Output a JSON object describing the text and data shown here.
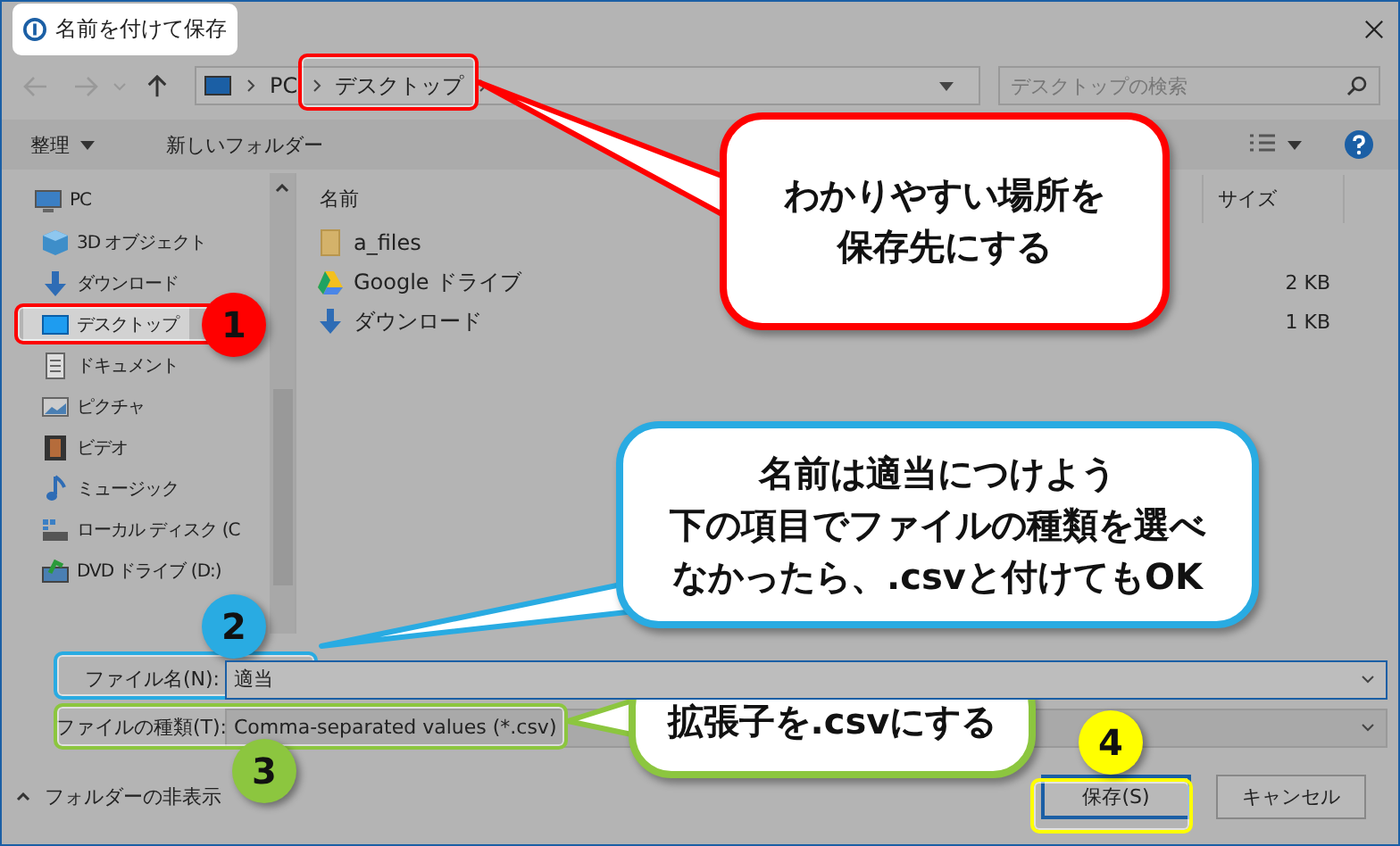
{
  "window": {
    "title": "名前を付けて保存"
  },
  "address_bar": {
    "segments": [
      "PC",
      "デスクトップ"
    ]
  },
  "search": {
    "placeholder": "デスクトップの検索"
  },
  "toolbar": {
    "organize": "整理",
    "new_folder": "新しいフォルダー"
  },
  "sidebar": {
    "items": [
      {
        "label": "PC",
        "kind": "pc",
        "selected": false,
        "children": [
          {
            "label": "3D オブジェクト",
            "kind": "cube",
            "selected": false
          },
          {
            "label": "ダウンロード",
            "kind": "download",
            "selected": false
          },
          {
            "label": "デスクトップ",
            "kind": "desktop",
            "selected": true
          },
          {
            "label": "ドキュメント",
            "kind": "document",
            "selected": false
          },
          {
            "label": "ピクチャ",
            "kind": "pictures",
            "selected": false
          },
          {
            "label": "ビデオ",
            "kind": "video",
            "selected": false
          },
          {
            "label": "ミュージック",
            "kind": "music",
            "selected": false
          },
          {
            "label": "ローカル ディスク (C",
            "kind": "drive",
            "selected": false
          },
          {
            "label": "DVD ドライブ (D:)",
            "kind": "dvd",
            "selected": false
          }
        ]
      }
    ]
  },
  "file_list": {
    "columns": [
      "名前",
      "サイズ"
    ],
    "rows": [
      {
        "name": "a_files",
        "kind": "folder"
      },
      {
        "name": "Google ドライブ",
        "kind": "gdrive",
        "size": "2 KB"
      },
      {
        "name": "ダウンロード",
        "kind": "download",
        "size": "1 KB"
      }
    ]
  },
  "form": {
    "file_name_label": "ファイル名(N):",
    "file_name": "適当",
    "file_type_label": "ファイルの種類(T):",
    "file_type": "Comma-separated values (*.csv)"
  },
  "hide_folders": "フォルダーの非表示",
  "buttons": [
    "保存(S)",
    "キャンセル"
  ],
  "annotations": [
    {
      "number": "1",
      "color": "#ff0000",
      "lines": [
        "わかりやすい場所を",
        "保存先にする"
      ]
    },
    {
      "number": "2",
      "color": "#29abe2",
      "lines": [
        "名前は適当につけよう",
        "下の項目でファイルの種類を選べ",
        "なかったら、.csvと付けてもOK"
      ]
    },
    {
      "number": "3",
      "color": "#8cc63f",
      "lines": [
        "拡張子を.csvにする"
      ]
    },
    {
      "number": "4",
      "color": "#ffff00"
    }
  ]
}
